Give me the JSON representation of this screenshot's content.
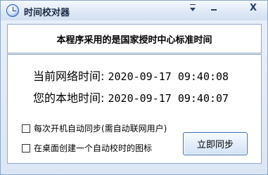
{
  "window": {
    "title": "时间校对器",
    "icon": "clock-icon",
    "titlebar_buttons": {
      "menu_icon": "menu-dropdown-icon",
      "minimize_icon": "minimize-icon",
      "close_label": "X"
    }
  },
  "banner": {
    "text": "本程序采用的是国家授时中心标准时间"
  },
  "network_time": {
    "label": "当前网络时间:",
    "value": "2020-09-17 09:40:08"
  },
  "local_time": {
    "label": "您的本地时间:",
    "value": "2020-09-17 09:40:07"
  },
  "options": [
    {
      "label": "每次开机自动同步(需自动联网用户)",
      "checked": false
    },
    {
      "label": "在桌面创建一个自动校时的图标",
      "checked": false
    }
  ],
  "buttons": {
    "sync_now": "立即同步"
  },
  "colors": {
    "window_border": "#8ba6c9",
    "button_border": "#3c6fb4"
  }
}
